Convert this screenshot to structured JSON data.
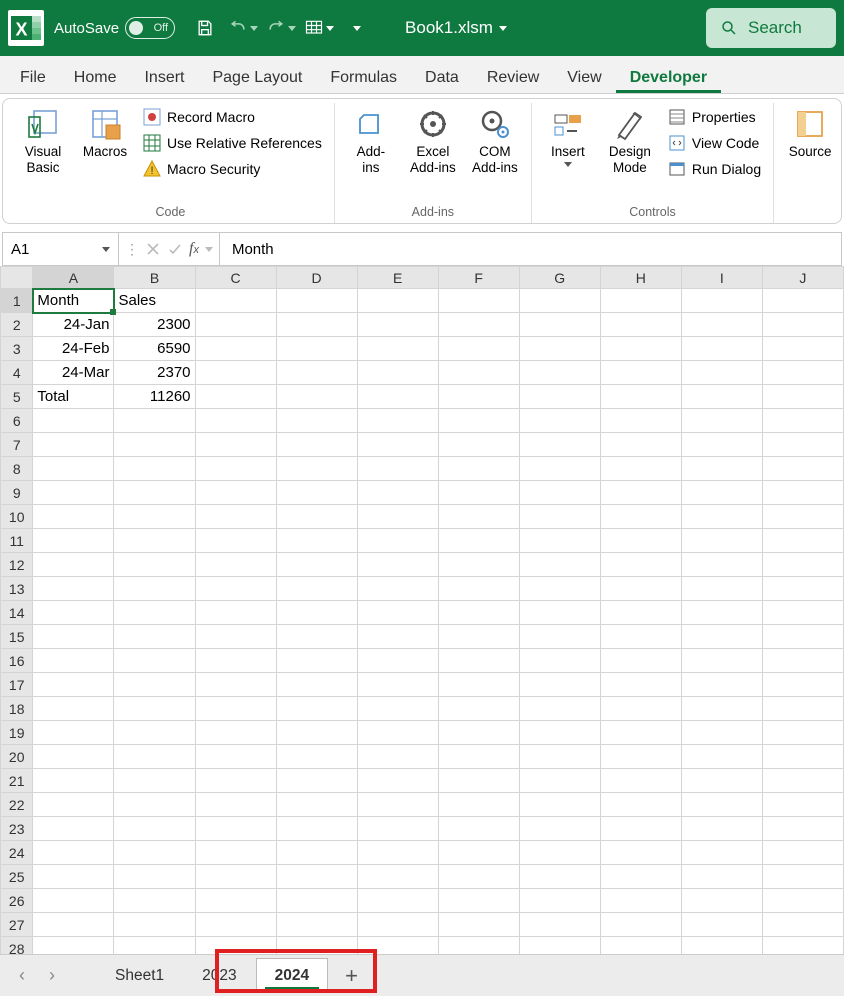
{
  "titlebar": {
    "autosave_label": "AutoSave",
    "autosave_state": "Off",
    "filename": "Book1.xlsm",
    "search_label": "Search"
  },
  "ribbon_tabs": [
    "File",
    "Home",
    "Insert",
    "Page Layout",
    "Formulas",
    "Data",
    "Review",
    "View",
    "Developer"
  ],
  "active_tab": "Developer",
  "ribbon": {
    "code": {
      "visual_basic": "Visual\nBasic",
      "macros": "Macros",
      "record_macro": "Record Macro",
      "use_relative": "Use Relative References",
      "macro_security": "Macro Security",
      "group": "Code"
    },
    "addins": {
      "addins": "Add-\nins",
      "excel_addins": "Excel\nAdd-ins",
      "com_addins": "COM\nAdd-ins",
      "group": "Add-ins"
    },
    "controls": {
      "insert": "Insert",
      "design_mode": "Design\nMode",
      "properties": "Properties",
      "view_code": "View Code",
      "run_dialog": "Run Dialog",
      "group": "Controls"
    },
    "xml": {
      "source": "Source"
    }
  },
  "formula_bar": {
    "namebox": "A1",
    "formula": "Month"
  },
  "columns": [
    "A",
    "B",
    "C",
    "D",
    "E",
    "F",
    "G",
    "H",
    "I",
    "J"
  ],
  "row_count": 28,
  "selected_cell": "A1",
  "cells": {
    "A1": "Month",
    "B1": "Sales",
    "A2": "24-Jan",
    "B2": "2300",
    "A3": "24-Feb",
    "B3": "6590",
    "A4": "24-Mar",
    "B4": "2370",
    "A5": "Total",
    "B5": "11260"
  },
  "numeric_cells": [
    "A2",
    "A3",
    "A4",
    "B2",
    "B3",
    "B4",
    "B5"
  ],
  "sheet_tabs": [
    "Sheet1",
    "2023",
    "2024"
  ],
  "active_sheet": "2024"
}
